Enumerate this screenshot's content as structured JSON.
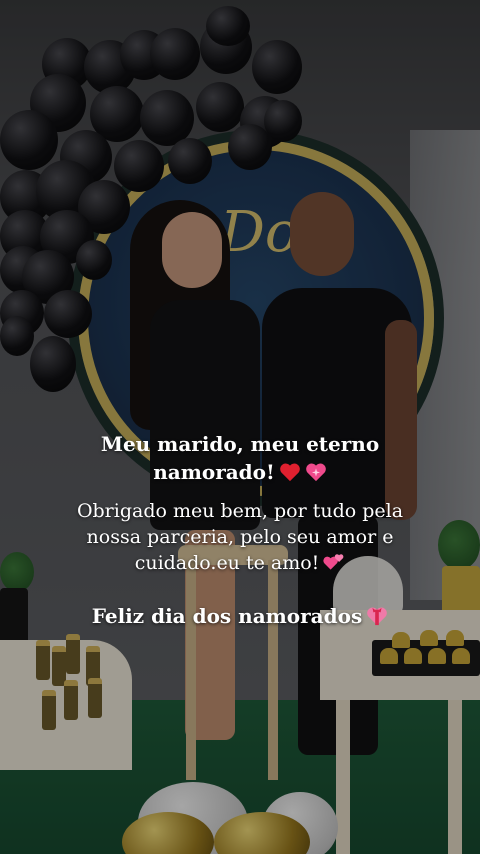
{
  "story": {
    "title_text": "Meu marido, meu eterno namorado!",
    "body_text": "Obrigado meu bem, por tudo pela nossa parceria, pelo seu amor e cuidado.eu te amo!",
    "footer_text": "Feliz dia dos namorados",
    "backdrop_text": "Dog",
    "emoji_title": [
      "red-heart-icon",
      "sparkling-heart-icon"
    ],
    "emoji_body": "two-hearts-icon",
    "emoji_footer": "heart-with-ribbon-icon"
  },
  "colors": {
    "text": "#ffffff",
    "red_heart": "#e0202f",
    "pink_heart": "#ef4a8c",
    "accent_gold": "#c9b25c"
  }
}
